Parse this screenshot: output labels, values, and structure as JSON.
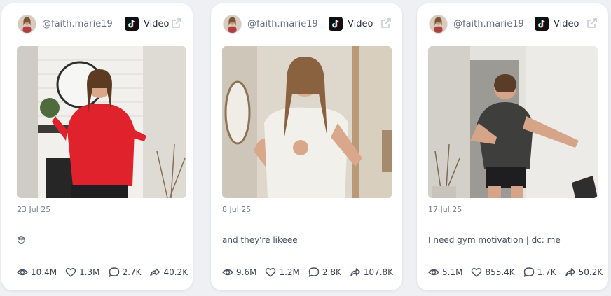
{
  "posts": [
    {
      "username": "@faith.marie19",
      "platform": "Video",
      "date": "23 Jul 25",
      "caption": "😳",
      "stats": {
        "views": "10.4M",
        "likes": "1.3M",
        "comments": "2.7K",
        "shares": "40.2K"
      },
      "palette": {
        "wall": "#d9d6d0",
        "accent": "#e0222c",
        "floor": "#b9b2a8"
      }
    },
    {
      "username": "@faith.marie19",
      "platform": "Video",
      "date": "8 Jul 25",
      "caption": "and they're likeee",
      "stats": {
        "views": "9.6M",
        "likes": "1.2M",
        "comments": "2.8K",
        "shares": "107.8K"
      },
      "palette": {
        "wall": "#d8d2c6",
        "accent": "#f2f0ea",
        "floor": "#c4b7a2"
      }
    },
    {
      "username": "@faith.marie19",
      "platform": "Video",
      "date": "17 Jul 25",
      "caption": "I need gym motivation | dc: me",
      "stats": {
        "views": "5.1M",
        "likes": "855.4K",
        "comments": "1.7K",
        "shares": "50.2K"
      },
      "palette": {
        "wall": "#e4e2dd",
        "accent": "#3e3e3c",
        "floor": "#cfcac2"
      }
    }
  ],
  "icons": {
    "avatar": "avatar",
    "platform": "tiktok-icon",
    "open": "external-link-icon",
    "views": "eye-icon",
    "likes": "heart-icon",
    "comments": "comment-icon",
    "shares": "share-icon"
  }
}
